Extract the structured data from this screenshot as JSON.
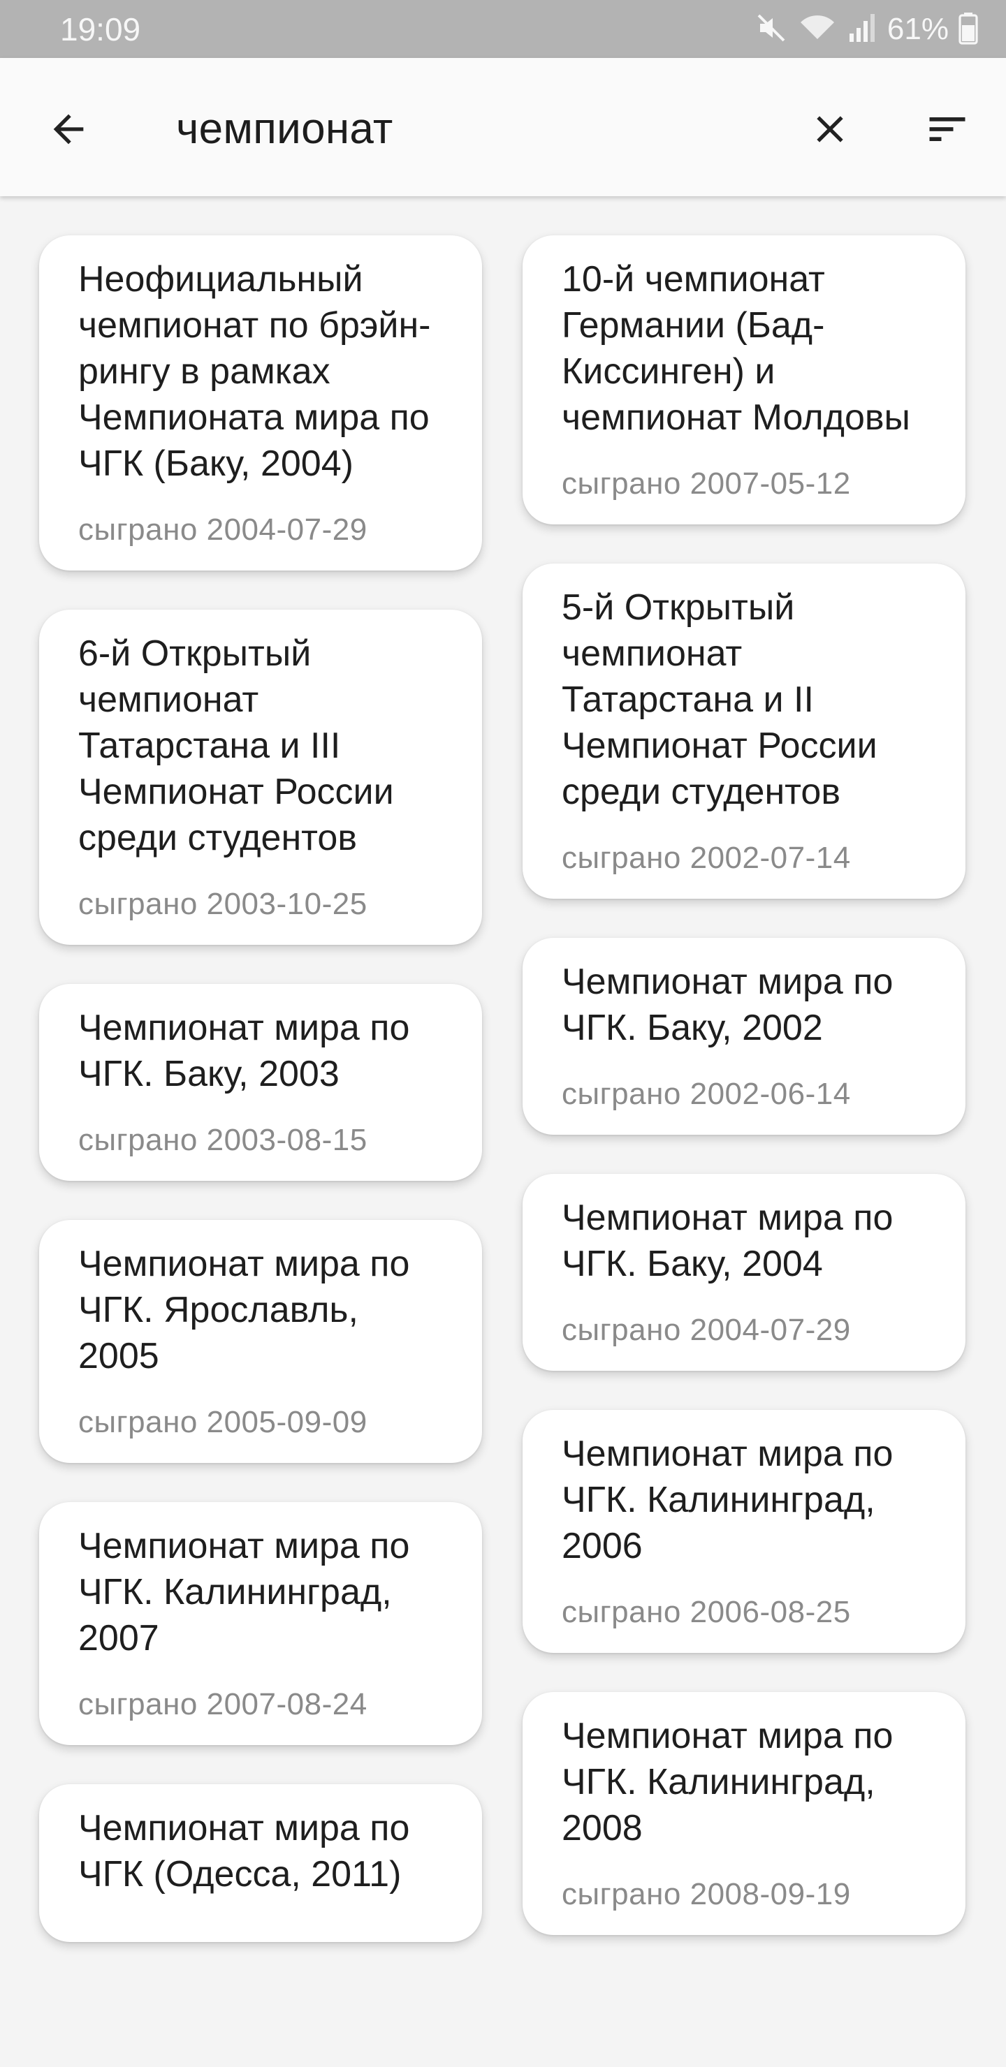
{
  "status_bar": {
    "time": "19:09",
    "battery_percent": "61%",
    "icons": [
      "mute-icon",
      "wifi-icon",
      "signal-icon",
      "battery-icon"
    ]
  },
  "toolbar": {
    "back_icon": "arrow-left-icon",
    "query": "чемпионат",
    "clear_icon": "close-icon",
    "sort_icon": "sort-icon"
  },
  "results": {
    "left": [
      {
        "title": "Неофициальный чемпионат по брэйн-рингу в рамках Чемпионата мира по ЧГК (Баку, 2004)",
        "date": "сыграно 2004-07-29"
      },
      {
        "title": "6-й Открытый чемпионат Татарстана и III Чемпионат России среди студентов",
        "date": "сыграно 2003-10-25"
      },
      {
        "title": "Чемпионат мира по ЧГК. Баку, 2003",
        "date": "сыграно 2003-08-15"
      },
      {
        "title": "Чемпионат мира по ЧГК. Ярославль, 2005",
        "date": "сыграно 2005-09-09"
      },
      {
        "title": "Чемпионат мира по ЧГК. Калининград, 2007",
        "date": "сыграно 2007-08-24"
      },
      {
        "title": "Чемпионат мира по ЧГК (Одесса, 2011)",
        "date": ""
      }
    ],
    "right": [
      {
        "title": "10-й чемпионат Германии (Бад-Киссинген) и чемпионат Молдовы",
        "date": "сыграно 2007-05-12"
      },
      {
        "title": "5-й Открытый чемпионат Татарстана и II Чемпионат России среди студентов",
        "date": "сыграно 2002-07-14"
      },
      {
        "title": "Чемпионат мира по ЧГК. Баку, 2002",
        "date": "сыграно 2002-06-14"
      },
      {
        "title": "Чемпионат мира по ЧГК. Баку, 2004",
        "date": "сыграно 2004-07-29"
      },
      {
        "title": "Чемпионат мира по ЧГК. Калининград, 2006",
        "date": "сыграно 2006-08-25"
      },
      {
        "title": "Чемпионат мира по ЧГК. Калининград, 2008",
        "date": "сыграно 2008-09-19"
      }
    ]
  }
}
